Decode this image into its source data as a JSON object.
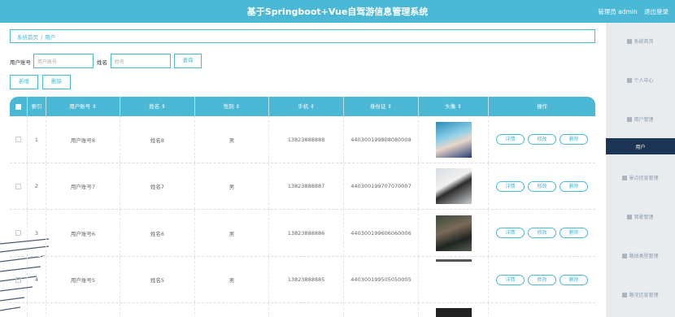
{
  "header": {
    "title": "基于Springboot+Vue自驾游信息管理系统",
    "user_label": "管理员 admin",
    "logout_label": "退出登录"
  },
  "sidebar": {
    "items": [
      {
        "label": "系统首页",
        "icon": "home-icon"
      },
      {
        "label": "个人中心",
        "icon": "person-icon"
      },
      {
        "label": "用户管理",
        "icon": "users-icon"
      },
      {
        "label": "用户",
        "icon": "",
        "active": true
      },
      {
        "label": "景点信息管理",
        "icon": "scenic-icon"
      },
      {
        "label": "驾驶管理",
        "icon": "grid-icon"
      },
      {
        "label": "路线类型管理",
        "icon": "chat-icon"
      },
      {
        "label": "路况信息管理",
        "icon": "grid-icon"
      }
    ]
  },
  "breadcrumb": {
    "home": "系统首页",
    "current": "用户"
  },
  "search": {
    "account_label": "用户账号",
    "account_placeholder": "用户账号",
    "name_label": "姓名",
    "name_placeholder": "姓名",
    "query_button": "查询"
  },
  "actions": {
    "add": "新增",
    "delete": "删除"
  },
  "table": {
    "columns": [
      "索引",
      "用户账号",
      "姓名",
      "性别",
      "手机",
      "身份证",
      "头像",
      "操作"
    ],
    "row_buttons": {
      "detail": "详情",
      "edit": "修改",
      "delete": "删除"
    },
    "rows": [
      {
        "index": "1",
        "account": "用户账号8",
        "name": "姓名8",
        "gender": "男",
        "phone": "13823888888",
        "idcard": "440300199808080008",
        "avatar": "a1"
      },
      {
        "index": "2",
        "account": "用户账号7",
        "name": "姓名7",
        "gender": "男",
        "phone": "13823888887",
        "idcard": "440300199707070007",
        "avatar": "a2"
      },
      {
        "index": "3",
        "account": "用户账号6",
        "name": "姓名6",
        "gender": "男",
        "phone": "13823888886",
        "idcard": "440300199606060006",
        "avatar": "a3"
      },
      {
        "index": "4",
        "account": "用户账号5",
        "name": "姓名5",
        "gender": "男",
        "phone": "13823888885",
        "idcard": "440300199505050005",
        "avatar": "a4"
      }
    ]
  },
  "colors": {
    "accent": "#4bb8d6",
    "sidebar_active": "#1c3554"
  }
}
